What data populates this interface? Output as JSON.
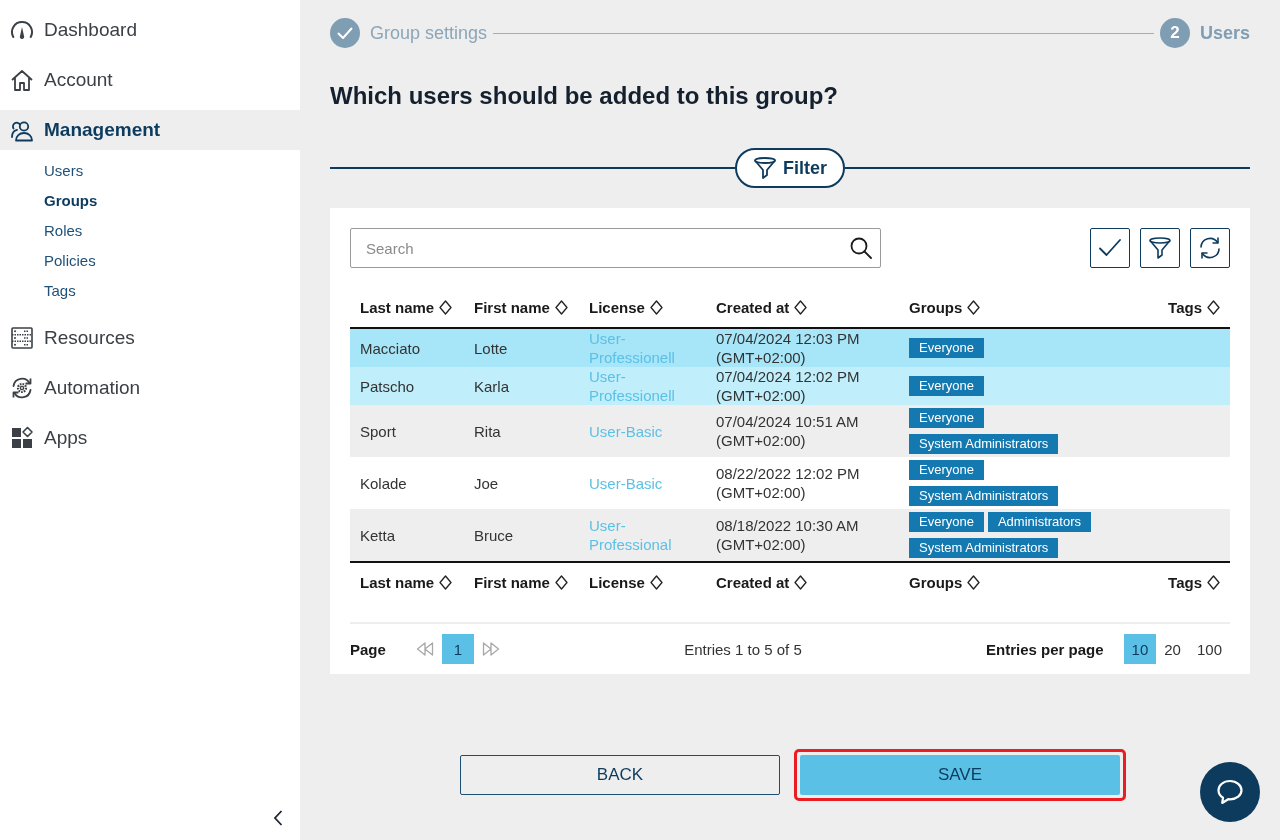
{
  "sidebar": {
    "items": [
      {
        "label": "Dashboard",
        "selected": false
      },
      {
        "label": "Account",
        "selected": false
      },
      {
        "label": "Management",
        "selected": true,
        "children": [
          {
            "label": "Users",
            "selected": false
          },
          {
            "label": "Groups",
            "selected": true
          },
          {
            "label": "Roles",
            "selected": false
          },
          {
            "label": "Policies",
            "selected": false
          },
          {
            "label": "Tags",
            "selected": false
          }
        ]
      },
      {
        "label": "Resources",
        "selected": false
      },
      {
        "label": "Automation",
        "selected": false
      },
      {
        "label": "Apps",
        "selected": false
      }
    ]
  },
  "stepper": {
    "steps": [
      {
        "label": "Group settings",
        "completed": true,
        "active": false
      },
      {
        "number": "2",
        "label": "Users",
        "completed": false,
        "active": true
      }
    ]
  },
  "heading": "Which users should be added to this group?",
  "filter_button": {
    "label": "Filter"
  },
  "search": {
    "placeholder": "Search"
  },
  "table": {
    "columns": [
      "Last name",
      "First name",
      "License",
      "Created at",
      "Groups",
      "Tags"
    ],
    "rows": [
      {
        "last_name": "Macciato",
        "first_name": "Lotte",
        "license": "User-Professionell",
        "created_at": "07/04/2024 12:03 PM (GMT+02:00)",
        "groups": [
          "Everyone"
        ],
        "selected": true
      },
      {
        "last_name": "Patscho",
        "first_name": "Karla",
        "license": "User-Professionell",
        "created_at": "07/04/2024 12:02 PM (GMT+02:00)",
        "groups": [
          "Everyone"
        ],
        "selected": true
      },
      {
        "last_name": "Sport",
        "first_name": "Rita",
        "license": "User-Basic",
        "created_at": "07/04/2024 10:51 AM (GMT+02:00)",
        "groups": [
          "Everyone",
          "System Administrators"
        ],
        "selected": false
      },
      {
        "last_name": "Kolade",
        "first_name": "Joe",
        "license": "User-Basic",
        "created_at": "08/22/2022 12:02 PM (GMT+02:00)",
        "groups": [
          "Everyone",
          "System Administrators"
        ],
        "selected": false
      },
      {
        "last_name": "Ketta",
        "first_name": "Bruce",
        "license": "User-Professional",
        "created_at": "08/18/2022 10:30 AM (GMT+02:00)",
        "groups": [
          "Everyone",
          "Administrators",
          "System Administrators"
        ],
        "selected": false
      }
    ],
    "footer_columns": [
      "Last name",
      "First name",
      "License",
      "Created at",
      "Groups",
      "Tags"
    ]
  },
  "pagination": {
    "label": "Page",
    "prev": {
      "disabled": true
    },
    "pages": [
      {
        "label": "1",
        "selected": true
      }
    ],
    "next": {
      "disabled": true
    },
    "summary": "Entries 1 to 5 of 5",
    "per_page_label": "Entries per page",
    "per_page_options": [
      {
        "label": "10",
        "selected": true
      },
      {
        "label": "20",
        "selected": false
      },
      {
        "label": "100",
        "selected": false
      }
    ]
  },
  "actions": [
    {
      "label": "BACK",
      "kind": "secondary",
      "highlighted": false
    },
    {
      "label": "SAVE",
      "kind": "primary",
      "highlighted": true
    }
  ]
}
